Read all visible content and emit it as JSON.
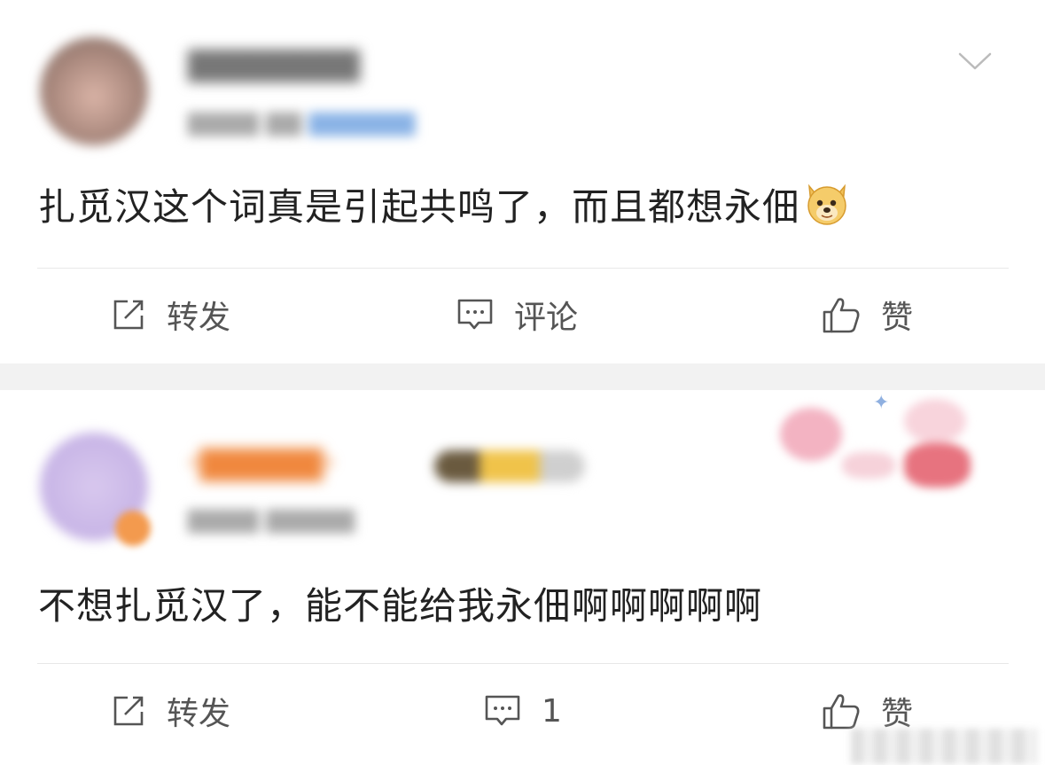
{
  "posts": [
    {
      "content": "扎觅汉这个词真是引起共鸣了，而且都想永佃",
      "emoji": "doge-emoji",
      "actions": {
        "repost": "转发",
        "comment": "评论",
        "like": "赞"
      }
    },
    {
      "content": "不想扎觅汉了，能不能给我永佃啊啊啊啊啊",
      "actions": {
        "repost": "转发",
        "comment": "1",
        "like": "赞"
      }
    }
  ],
  "colors": {
    "text": "#222222",
    "action_text": "#555555",
    "divider": "#e8e8e8",
    "separator_bg": "#f2f2f2"
  },
  "icons": [
    "chevron-down-icon",
    "repost-icon",
    "comment-icon",
    "like-icon",
    "doge-emoji"
  ]
}
